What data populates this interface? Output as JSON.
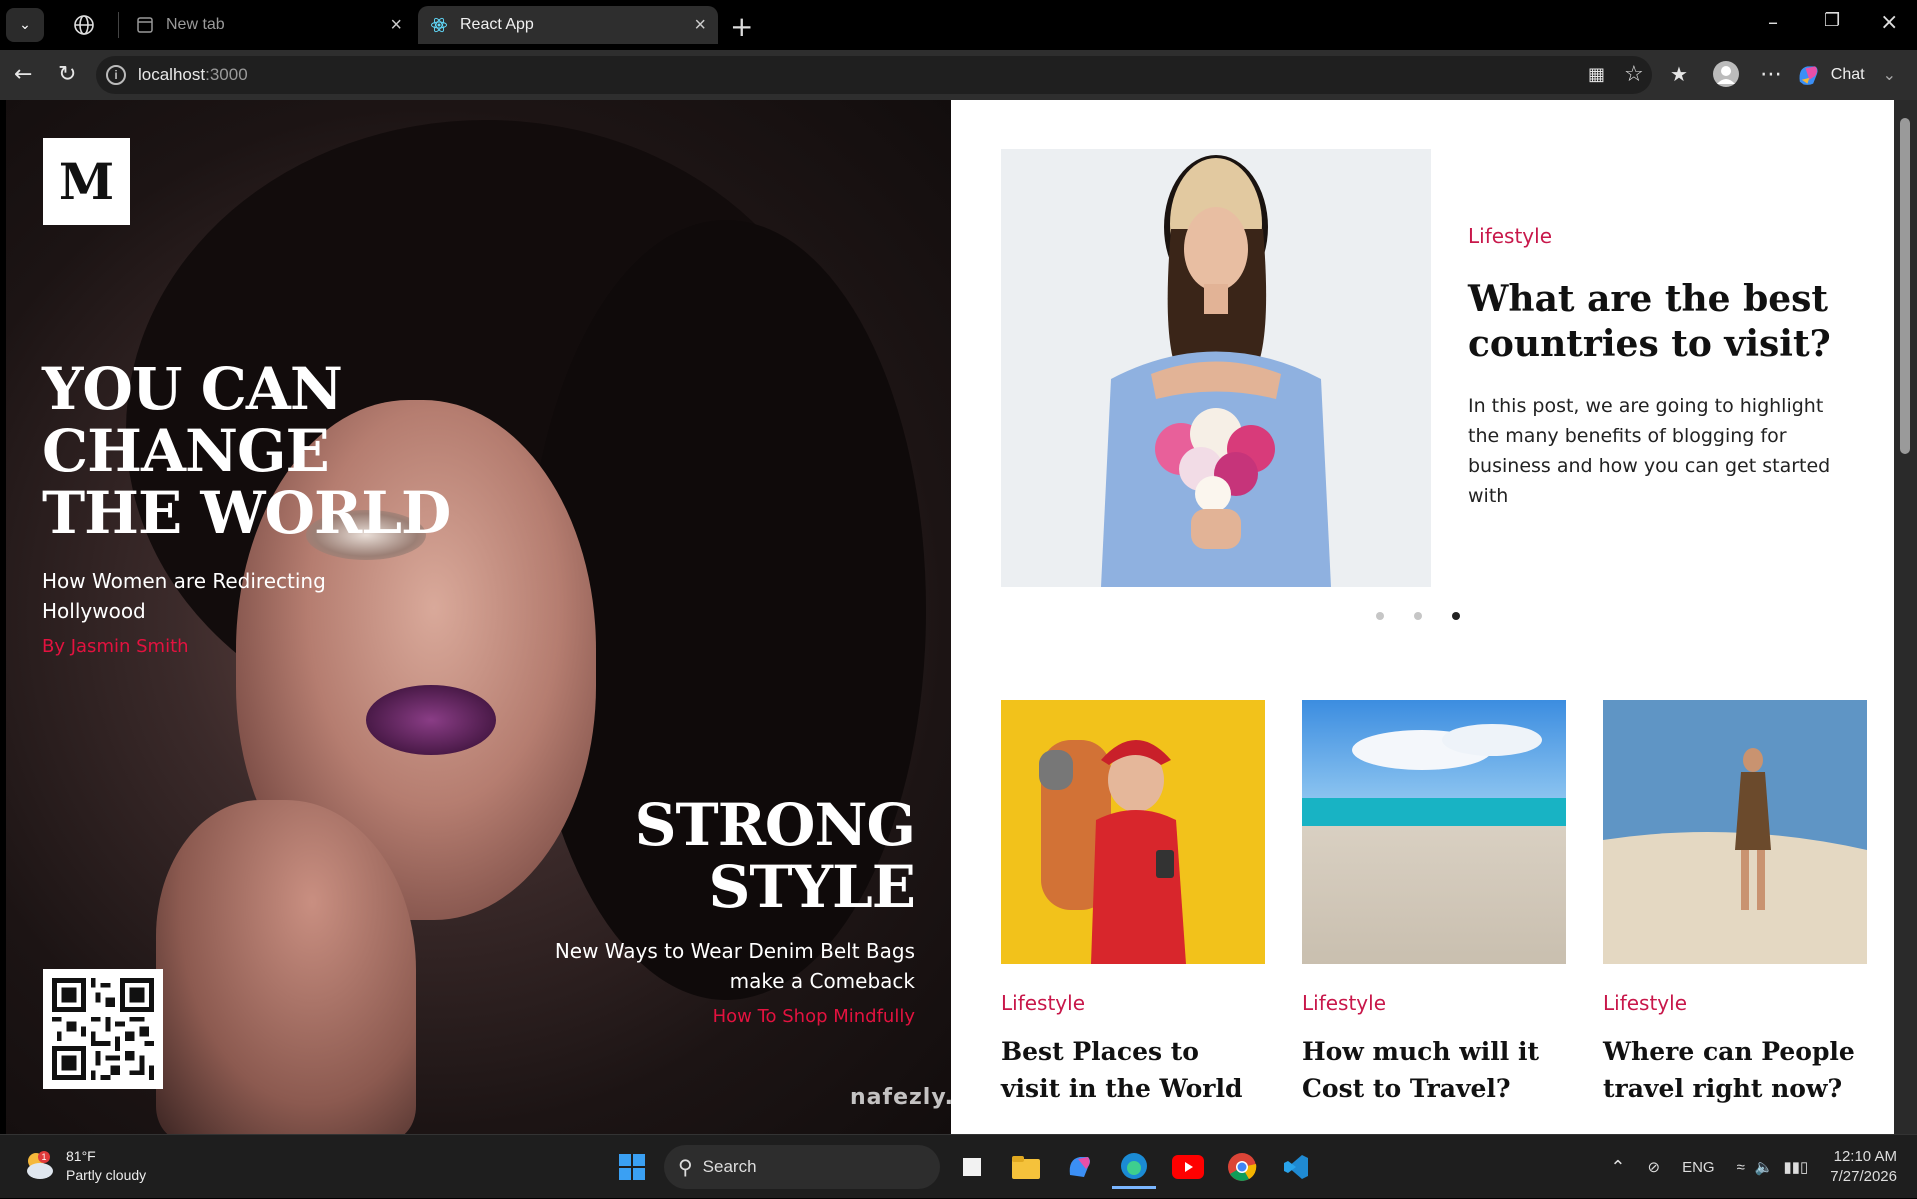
{
  "browser": {
    "tabs": [
      {
        "label": "New tab",
        "active": false
      },
      {
        "label": "React App",
        "active": true
      }
    ],
    "address": {
      "host": "localhost",
      "port": ":3000"
    },
    "chat_label": "Chat"
  },
  "hero": {
    "logo": "M",
    "headline_1": [
      "YOU CAN",
      "CHANGE",
      "THE WORLD"
    ],
    "subtitle_1": "How Women are Redirecting Hollywood",
    "byline_1": "By Jasmin Smith",
    "headline_2": [
      "STRONG",
      "STYLE"
    ],
    "subtitle_2": "New Ways to Wear Denim Belt Bags make a Comeback",
    "byline_2": "How To Shop Mindfully"
  },
  "featured": {
    "category": "Lifestyle",
    "title": "What are the best countries to visit?",
    "description": "In this post, we are going to highlight the many benefits of blogging for business and how you can get started with",
    "slides": 3,
    "active_slide": 3
  },
  "cards": [
    {
      "category": "Lifestyle",
      "title": "Best Places to visit in the World"
    },
    {
      "category": "Lifestyle",
      "title": "How much will it Cost to Travel?"
    },
    {
      "category": "Lifestyle",
      "title": "Where can People travel right now?"
    }
  ],
  "taskbar": {
    "weather_temp": "81°F",
    "weather_desc": "Partly cloudy",
    "weather_badge": "1",
    "search_label": "Search",
    "lang": "ENG",
    "time": "12:10 AM",
    "date": "7/27/2026"
  },
  "watermark": "nafezly.com",
  "colors": {
    "accent": "#c8174a",
    "byline": "#e3123f"
  }
}
